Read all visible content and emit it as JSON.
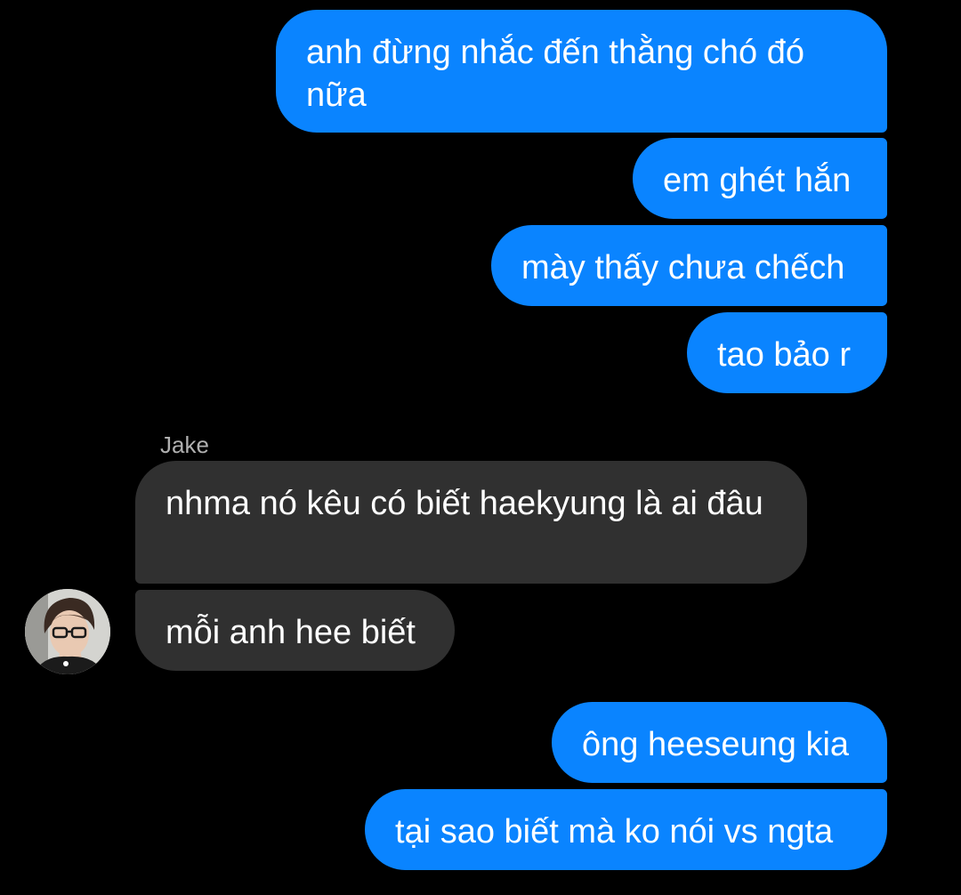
{
  "colors": {
    "background": "#000000",
    "outgoing_bubble": "#0a84ff",
    "incoming_bubble": "#303030",
    "text": "#ffffff",
    "sender_name": "#b0b0b0"
  },
  "conversation": {
    "messages": [
      {
        "direction": "outgoing",
        "text": "anh đừng nhắc đến thằng chó đó nữa"
      },
      {
        "direction": "outgoing",
        "text": "em ghét hắn"
      },
      {
        "direction": "outgoing",
        "text": "mày thấy chưa chếch"
      },
      {
        "direction": "outgoing",
        "text": "tao bảo r"
      },
      {
        "direction": "incoming",
        "sender": "Jake",
        "text": "nhma nó kêu có biết haekyung là ai đâu"
      },
      {
        "direction": "incoming",
        "text": "mỗi anh hee biết"
      },
      {
        "direction": "outgoing",
        "text": "ông heeseung kia"
      },
      {
        "direction": "outgoing",
        "text": "tại sao biết mà ko nói vs ngta"
      }
    ],
    "incoming_avatar": "user-avatar-photo"
  }
}
